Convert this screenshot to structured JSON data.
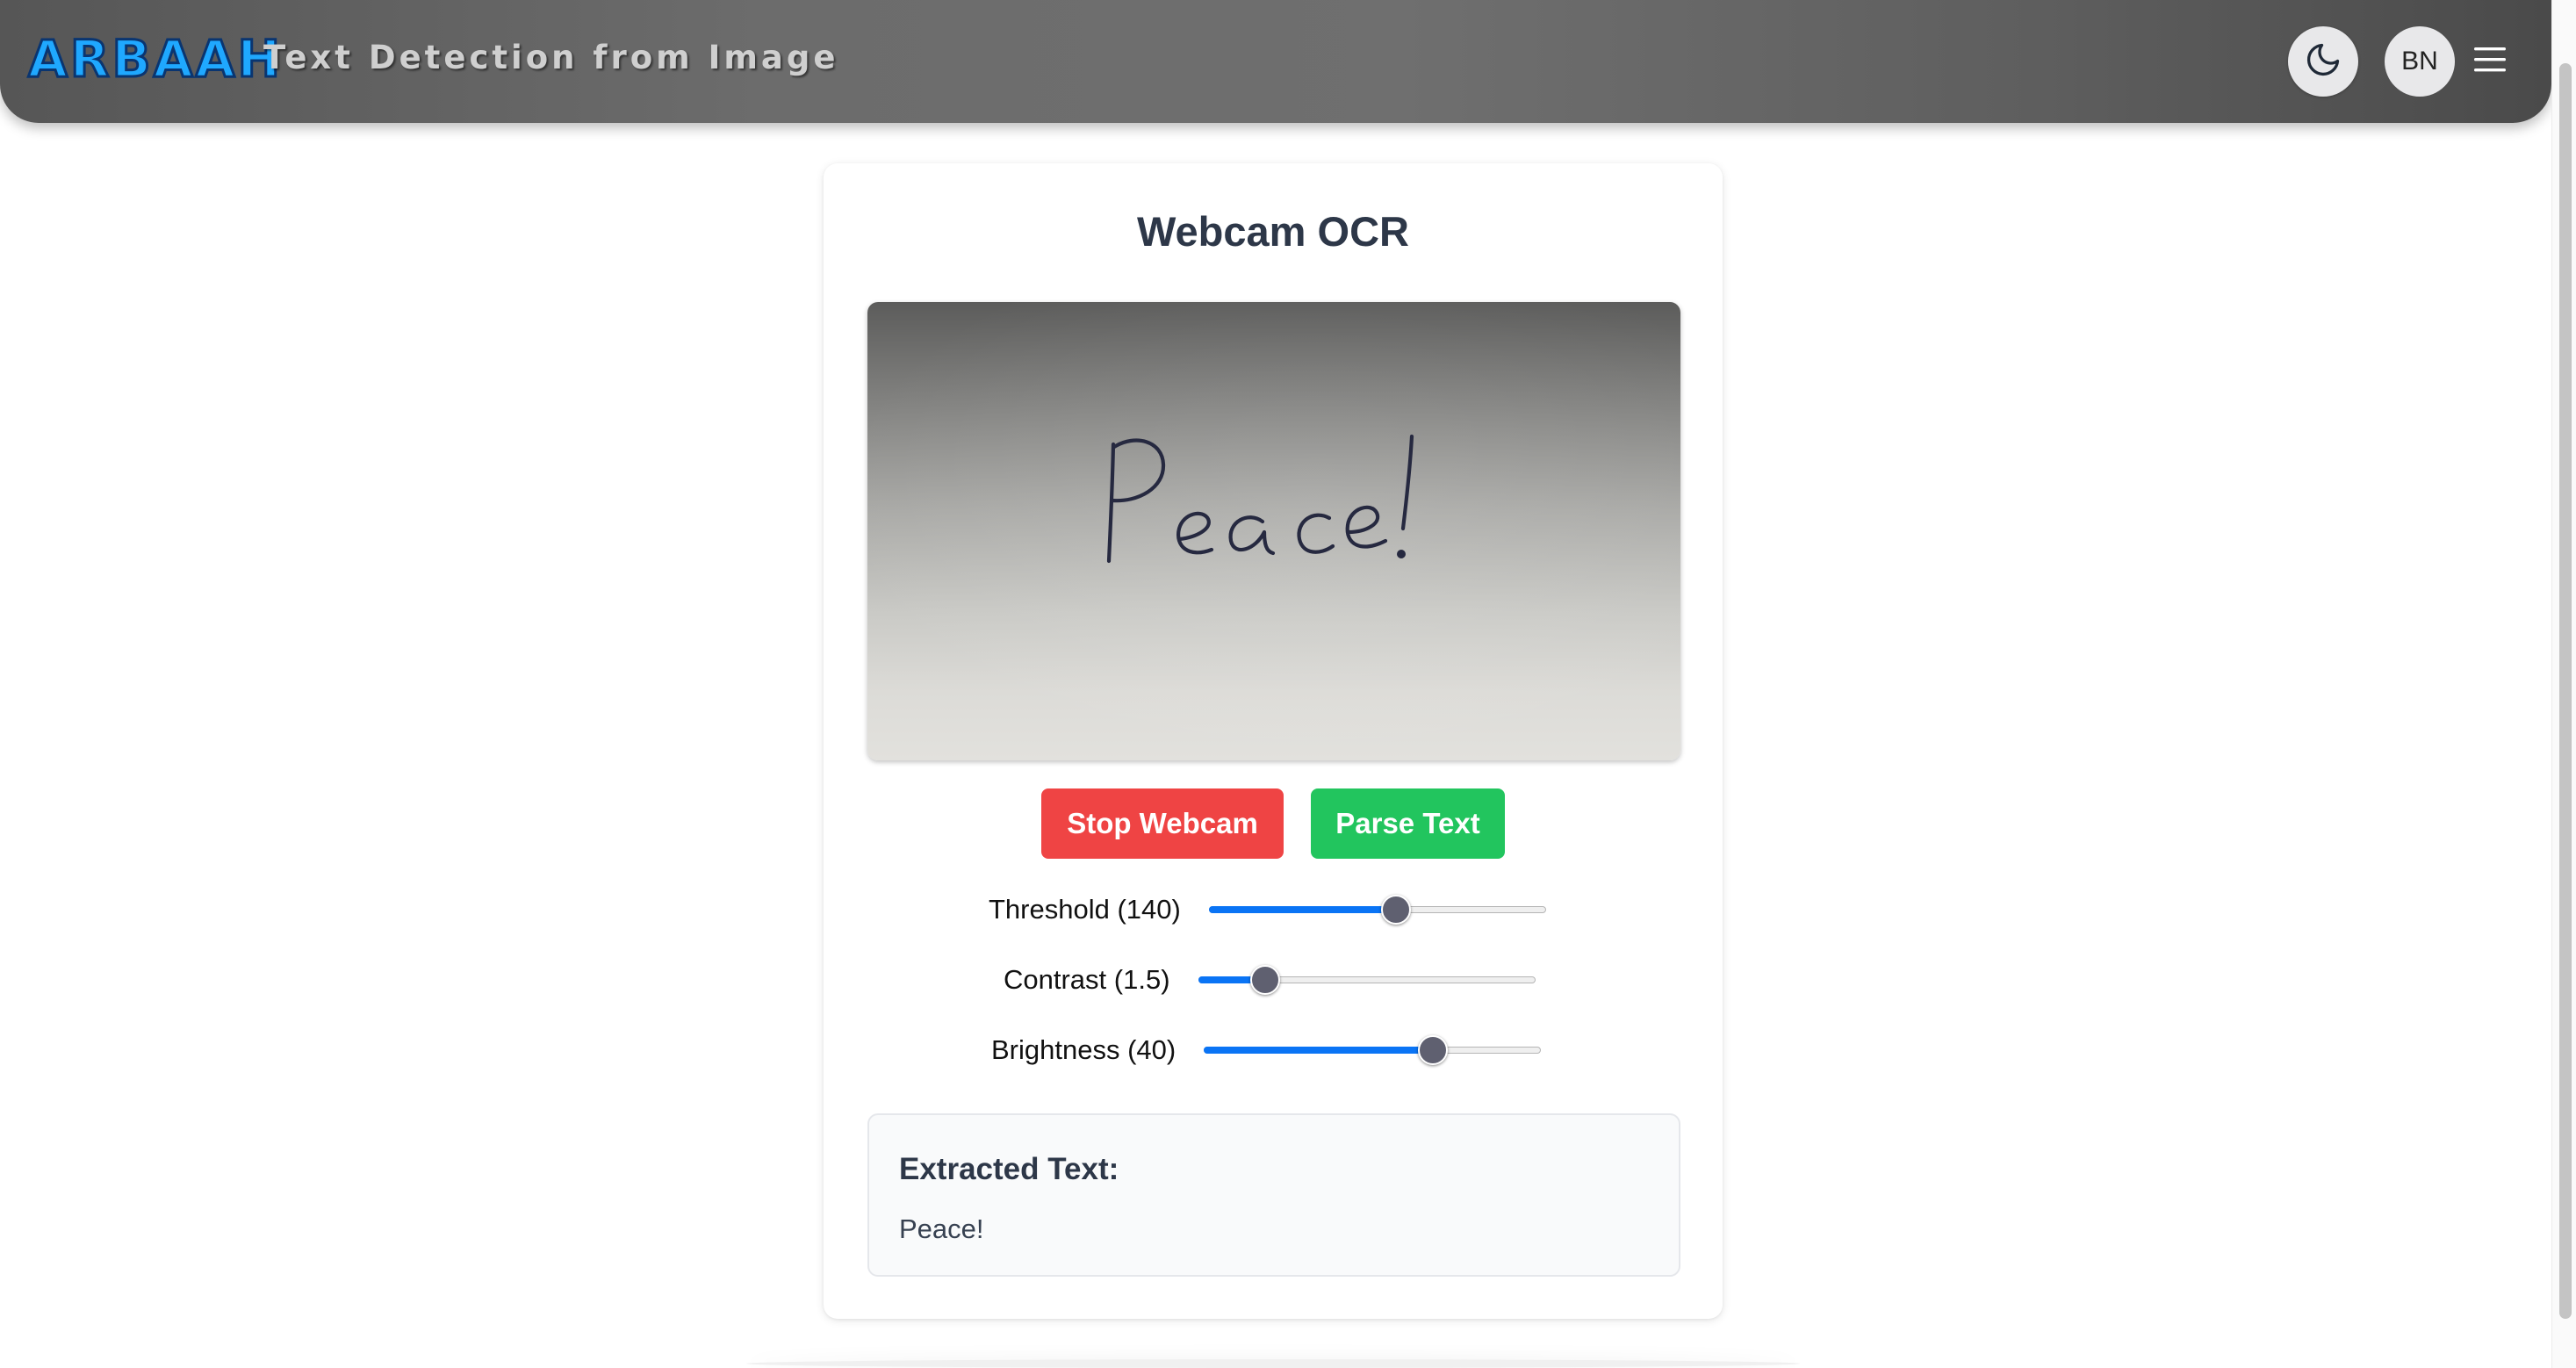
{
  "header": {
    "logo_text": "ARBAAH",
    "title": "Text Detection from Image",
    "theme_icon": "moon-icon",
    "avatar_initials": "BN",
    "menu_icon": "hamburger-menu-icon"
  },
  "card": {
    "title": "Webcam OCR",
    "webcam_preview_text": "Peace!",
    "buttons": {
      "stop_label": "Stop Webcam",
      "parse_label": "Parse Text"
    },
    "sliders": [
      {
        "label": "Threshold (140)",
        "fill_fraction": 0.555
      },
      {
        "label": "Contrast (1.5)",
        "fill_fraction": 0.2
      },
      {
        "label": "Brightness (40)",
        "fill_fraction": 0.68
      }
    ],
    "result": {
      "heading": "Extracted Text:",
      "text": "Peace!"
    }
  },
  "colors": {
    "stop_button": "#ef4444",
    "parse_button": "#22c55e",
    "slider_fill": "#0a74f5",
    "title_text": "#2d3748",
    "logo_blue": "#1fa8ff"
  }
}
